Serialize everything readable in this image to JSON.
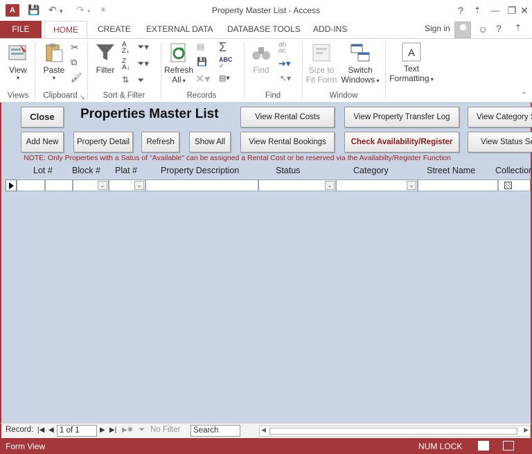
{
  "window": {
    "app_icon": "A",
    "title": "Property Master List - Access",
    "help": "?",
    "minimize": "—",
    "restore": "❐",
    "close": "✕"
  },
  "ribbon_tabs": {
    "file": "FILE",
    "home": "HOME",
    "create": "CREATE",
    "external": "EXTERNAL DATA",
    "dbtools": "DATABASE TOOLS",
    "addins": "ADD-INS",
    "signin": "Sign in"
  },
  "ribbon": {
    "view": "View",
    "views_group": "Views",
    "paste": "Paste",
    "clipboard_group": "Clipboard",
    "filter": "Filter",
    "sort_filter_group": "Sort & Filter",
    "refresh_1": "Refresh",
    "refresh_2": "All",
    "records_group": "Records",
    "find": "Find",
    "find_group": "Find",
    "size_to_1": "Size to",
    "size_to_2": "Fit Form",
    "switch_1": "Switch",
    "switch_2": "Windows",
    "window_group": "Window",
    "text_1": "Text",
    "text_2": "Formatting"
  },
  "form": {
    "title": "Properties Master List",
    "close_btn": "Close",
    "add_new_btn": "Add New",
    "property_detail_btn": "Property Detail",
    "refresh_btn": "Refresh",
    "show_all_btn": "Show All",
    "view_rental_costs_btn": "View Rental Costs",
    "view_transfer_log_btn": "View Property Transfer Log",
    "view_category_btn": "View Category S",
    "view_rental_bookings_btn": "View Rental Bookings",
    "check_availability_btn": "Check Availability/Register",
    "view_status_btn": "View Status Se",
    "note": "NOTE: Only Properties with a Satus of \"Available\" can be assigned a Rental Cost or be reserved via the Availabilty/Register Function",
    "columns": {
      "lot": "Lot #",
      "block": "Block  #",
      "plat": "Plat  #",
      "desc": "Property Description",
      "status": "Status",
      "category": "Category",
      "street": "Street Name",
      "collection": "Collection"
    }
  },
  "record_nav": {
    "label": "Record:",
    "position": "1 of 1",
    "no_filter": "No Filter",
    "search": "Search"
  },
  "status_bar": {
    "mode": "Form View",
    "numlock": "NUM LOCK"
  },
  "colors": {
    "accent": "#a4373a",
    "form_bg": "#c9d5e5",
    "note_red": "#9c1c1c"
  }
}
